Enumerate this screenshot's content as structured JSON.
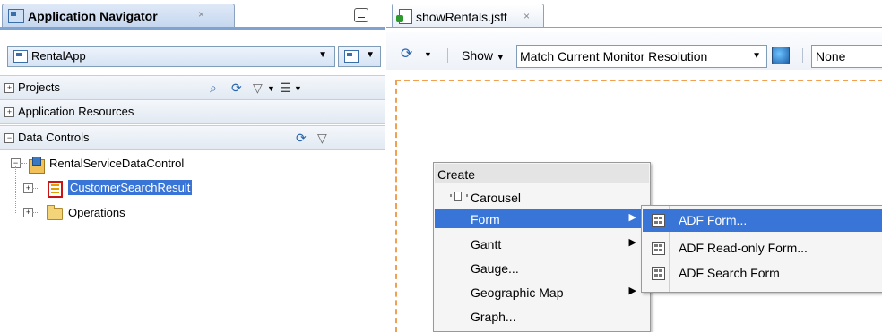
{
  "navigator": {
    "title": "Application Navigator",
    "close": "×",
    "app_selector": "RentalApp",
    "sections": {
      "projects": "Projects",
      "app_resources": "Application Resources",
      "data_controls": "Data Controls"
    },
    "tree": {
      "root": "RentalServiceDataControl",
      "children": [
        "CustomerSearchResult",
        "Operations"
      ]
    }
  },
  "editor": {
    "tab_title": "showRentals.jsff",
    "close": "×",
    "toolbar": {
      "show_label": "Show",
      "resolution": "Match Current Monitor Resolution",
      "none_value": "None"
    }
  },
  "context_menu": {
    "header": "Create",
    "items": [
      {
        "label": "Carousel",
        "submenu": false
      },
      {
        "label": "Form",
        "submenu": true,
        "highlighted": true
      },
      {
        "label": "Gantt",
        "submenu": true
      },
      {
        "label": "Gauge...",
        "submenu": false
      },
      {
        "label": "Geographic Map",
        "submenu": true
      },
      {
        "label": "Graph...",
        "submenu": false
      }
    ]
  },
  "form_submenu": {
    "items": [
      {
        "label": "ADF Form...",
        "highlighted": true
      },
      {
        "label": "ADF Read-only Form..."
      },
      {
        "label": "ADF Search Form"
      }
    ]
  },
  "colors": {
    "selection": "#3875d7",
    "canvas_border": "#f0a050",
    "panel_border": "#7fa3d1"
  }
}
